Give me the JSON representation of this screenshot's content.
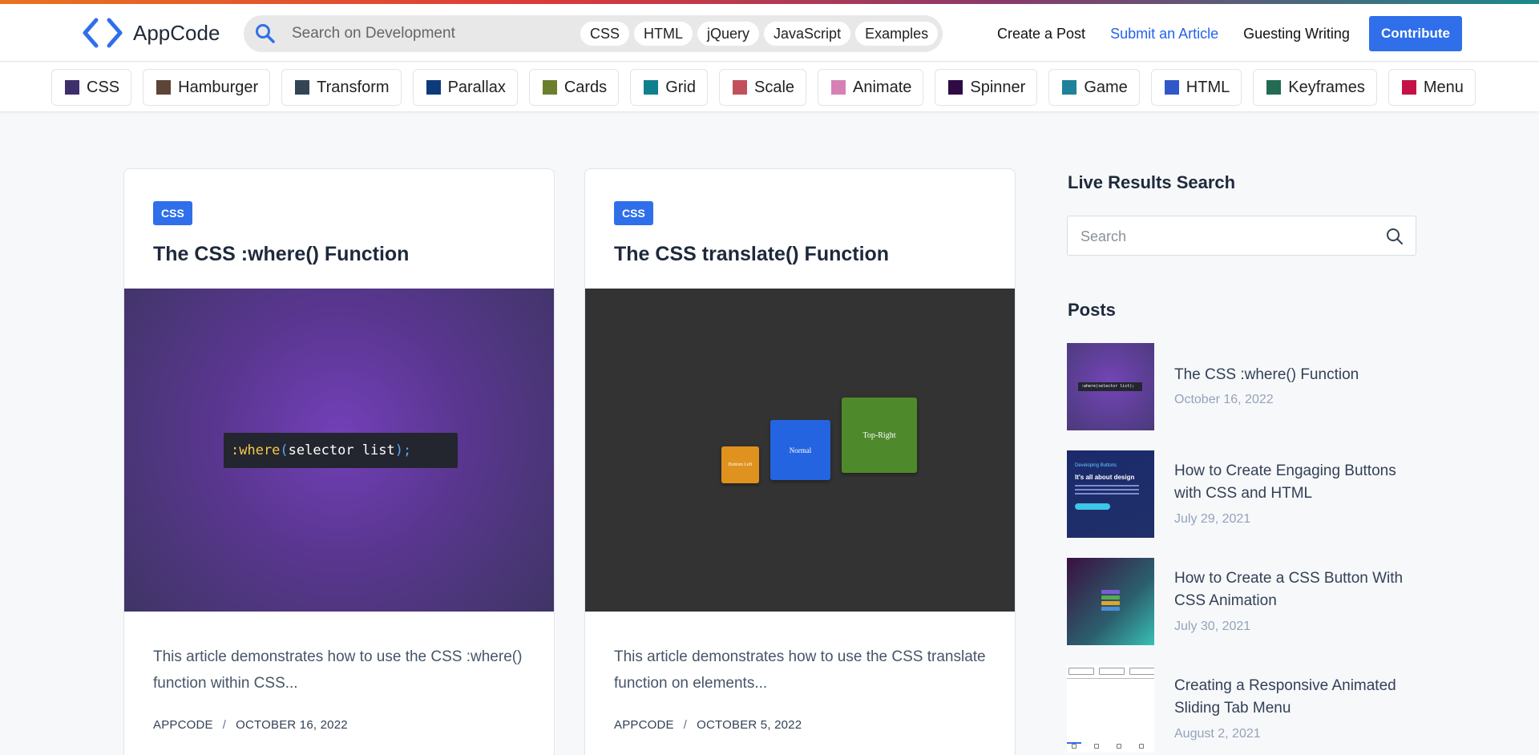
{
  "brand": {
    "name": "AppCode"
  },
  "header": {
    "search_placeholder": "Search on Development",
    "chips": [
      "CSS",
      "HTML",
      "jQuery",
      "JavaScript",
      "Examples"
    ],
    "links": [
      {
        "label": "Create a Post",
        "accent": false
      },
      {
        "label": "Submit an Article",
        "accent": true
      },
      {
        "label": "Guesting Writing",
        "accent": false
      }
    ],
    "contribute_label": "Contribute"
  },
  "tags": [
    {
      "label": "CSS",
      "color": "#3d2f6b"
    },
    {
      "label": "Hamburger",
      "color": "#5c4437"
    },
    {
      "label": "Transform",
      "color": "#334455"
    },
    {
      "label": "Parallax",
      "color": "#0f3a7a"
    },
    {
      "label": "Cards",
      "color": "#6b7e2c"
    },
    {
      "label": "Grid",
      "color": "#10808c"
    },
    {
      "label": "Scale",
      "color": "#c2505c"
    },
    {
      "label": "Animate",
      "color": "#d681b4"
    },
    {
      "label": "Spinner",
      "color": "#2e0b45"
    },
    {
      "label": "Game",
      "color": "#20819a"
    },
    {
      "label": "HTML",
      "color": "#3158c9"
    },
    {
      "label": "Keyframes",
      "color": "#236b52"
    },
    {
      "label": "Menu",
      "color": "#c41247"
    }
  ],
  "cards": [
    {
      "badge": "CSS",
      "title": "The CSS :where() Function",
      "code": {
        "selector": ":where",
        "open": "(",
        "arg": "selector list",
        "close": ");"
      },
      "excerpt": "This article demonstrates how to use the CSS :where() function within CSS...",
      "author": "APPCODE",
      "date": "OCTOBER 16, 2022"
    },
    {
      "badge": "CSS",
      "title": "The CSS translate() Function",
      "boxes": [
        "Bottom Left",
        "Normal",
        "Top-Right"
      ],
      "excerpt": "This article demonstrates how to use the CSS translate function on elements...",
      "author": "APPCODE",
      "date": "OCTOBER 5, 2022"
    }
  ],
  "sidebar": {
    "search_title": "Live Results Search",
    "search_placeholder": "Search",
    "posts_title": "Posts",
    "posts": [
      {
        "title": "The CSS :where() Function",
        "date": "October 16, 2022",
        "thumb_code": ":where(selector list);"
      },
      {
        "title": "How to Create Engaging Buttons with CSS and HTML",
        "date": "July 29, 2021",
        "thumb_kicker": "Developing Buttons",
        "thumb_heading": "It's all about design"
      },
      {
        "title": "How to Create a CSS Button With CSS Animation",
        "date": "July 30, 2021"
      },
      {
        "title": "Creating a Responsive Animated Sliding Tab Menu",
        "date": "August 2, 2021"
      }
    ]
  }
}
